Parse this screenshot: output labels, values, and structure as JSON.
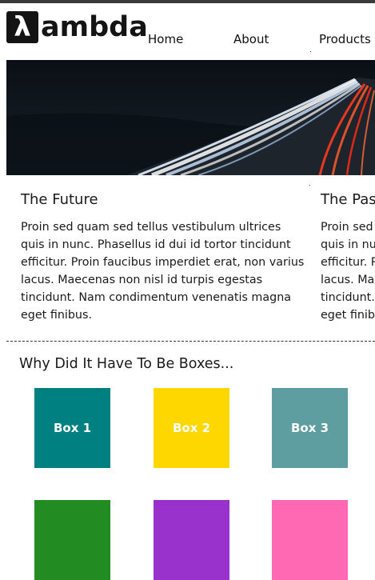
{
  "logo": {
    "mark": "λ",
    "text": "ambda"
  },
  "nav": {
    "items": [
      "Home",
      "About",
      "Products"
    ]
  },
  "hero": {
    "image": "highway light trails at night"
  },
  "articles": [
    {
      "title": "The Future",
      "lines": [
        "Proin sed quam sed tellus vestibulum ultrices",
        "quis in nunc. Phasellus id dui id tortor tincidunt",
        "efficitur. Proin faucibus imperdiet erat, non varius",
        "lacus. Maecenas non nisl id turpis egestas",
        "tincidunt. Nam condimentum venenatis magna",
        "eget finibus."
      ]
    },
    {
      "title": "The Past",
      "lines": [
        "Proin sed quam sed tellus vestibulum ultrices",
        "quis in nunc. Phasellus id dui id tortor tincidunt",
        "efficitur. Proin faucibus imperdiet erat, non varius",
        "lacus. Maecenas non nisl id turpis egestas",
        "tincidunt. Nam condimentum venenatis magna",
        "eget finibus."
      ]
    }
  ],
  "boxes_section": {
    "title": "Why Did It Have To Be Boxes...",
    "boxes": [
      {
        "label": "Box 1",
        "color": "#008080"
      },
      {
        "label": "Box 2",
        "color": "#FFD700"
      },
      {
        "label": "Box 3",
        "color": "#5F9EA0"
      },
      {
        "label": "",
        "color": "#228B22"
      },
      {
        "label": "",
        "color": "#9932CC"
      },
      {
        "label": "",
        "color": "#FF69B4"
      }
    ]
  }
}
